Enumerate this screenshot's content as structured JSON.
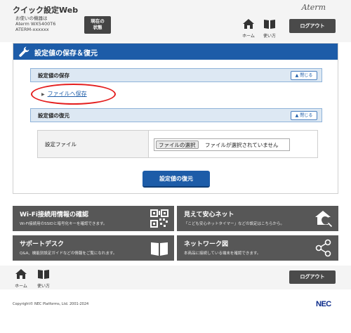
{
  "header": {
    "app_title": "クイック設定Web",
    "device_label": "お使いの機器は",
    "device_model": "Aterm WX5400T6",
    "device_id": "ATERM-xxxxxx",
    "status_button": "現在の\n状態",
    "brand": "Aterm",
    "home_label": "ホーム",
    "manual_label": "使い方",
    "logout_label": "ログアウト"
  },
  "main": {
    "title": "設定値の保存＆復元",
    "save_section": {
      "title": "設定値の保存",
      "close_label": "閉じる",
      "save_link": "ファイルへ保存"
    },
    "restore_section": {
      "title": "設定値の復元",
      "close_label": "閉じる",
      "file_label": "設定ファイル",
      "choose_button": "ファイルの選択",
      "no_file_text": "ファイルが選択されていません",
      "restore_button": "設定値の復元"
    }
  },
  "tiles": {
    "wifi": {
      "title": "Wi-Fi接続用情報の確認",
      "desc": "Wi-Fi接続用のSSIDと暗号化キーを確認できます。",
      "icon": "qr-code-icon"
    },
    "mimamoru": {
      "title": "見えて安心ネット",
      "desc": "「こども安心ネットタイマー」などの設定はこちらから。",
      "icon": "house-search-icon"
    },
    "support": {
      "title": "サポートデスク",
      "desc": "Q&A、機能別設定ガイドなどの情報をご覧になれます。",
      "icon": "book-icon"
    },
    "network": {
      "title": "ネットワーク図",
      "desc": "本商品に接続している端末を確認できます。",
      "icon": "network-share-icon"
    }
  },
  "footer": {
    "home_label": "ホーム",
    "manual_label": "使い方",
    "logout_label": "ログアウト",
    "copyright": "Copyright© NEC Platforms, Ltd. 2001-2024",
    "company_logo": "NEC"
  },
  "colors": {
    "primary_blue": "#1d5ca8",
    "tile_gray": "#575757",
    "highlight_red": "#e41e1e"
  }
}
